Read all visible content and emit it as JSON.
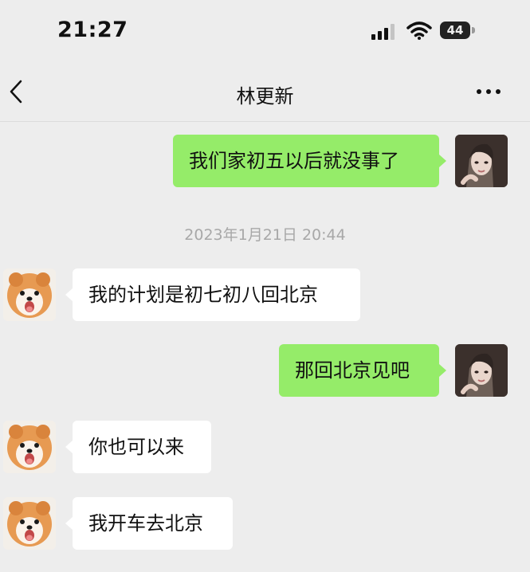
{
  "status_bar": {
    "time": "21:27",
    "battery": "44"
  },
  "header": {
    "title": "林更新"
  },
  "timestamp": "2023年1月21日 20:44",
  "messages": [
    {
      "direction": "outgoing",
      "text": "我们家初五以后就没事了"
    },
    {
      "direction": "incoming",
      "text": "我的计划是初七初八回北京"
    },
    {
      "direction": "outgoing",
      "text": "那回北京见吧"
    },
    {
      "direction": "incoming",
      "text": "你也可以来"
    },
    {
      "direction": "incoming",
      "text": "我开车去北京"
    }
  ],
  "colors": {
    "background": "#ededed",
    "outgoing_bubble": "#95ec69",
    "incoming_bubble": "#ffffff"
  }
}
